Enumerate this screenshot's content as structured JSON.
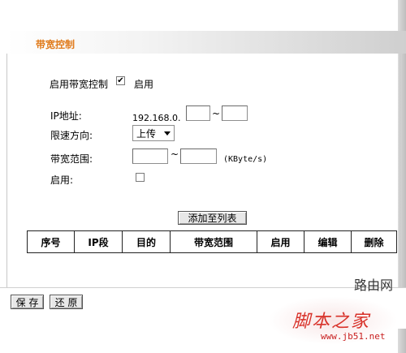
{
  "header": {
    "title": "带宽控制"
  },
  "enable_control": {
    "label": "启用带宽控制",
    "checked": true,
    "checkbox_text": "启用"
  },
  "form": {
    "ip_label": "IP地址:",
    "ip_prefix": "192.168.0.",
    "ip_separator": "~",
    "ip_start": "",
    "ip_end": "",
    "direction_label": "限速方向:",
    "direction_value": "上传",
    "bandwidth_label": "带宽范围:",
    "bw_separator": "~",
    "bw_min": "",
    "bw_max": "",
    "bw_unit": "(KByte/s)",
    "enable_label": "启用:",
    "enable_checked": false
  },
  "add_button": "添加至列表",
  "table": {
    "headers": [
      "序号",
      "IP段",
      "目的",
      "带宽范围",
      "启用",
      "编辑",
      "删除"
    ]
  },
  "buttons": {
    "save": "保 存",
    "restore": "还 原"
  },
  "watermark": {
    "site_name": "脚本之家",
    "site_url": "www.jb51.net",
    "brand": "路由网"
  }
}
